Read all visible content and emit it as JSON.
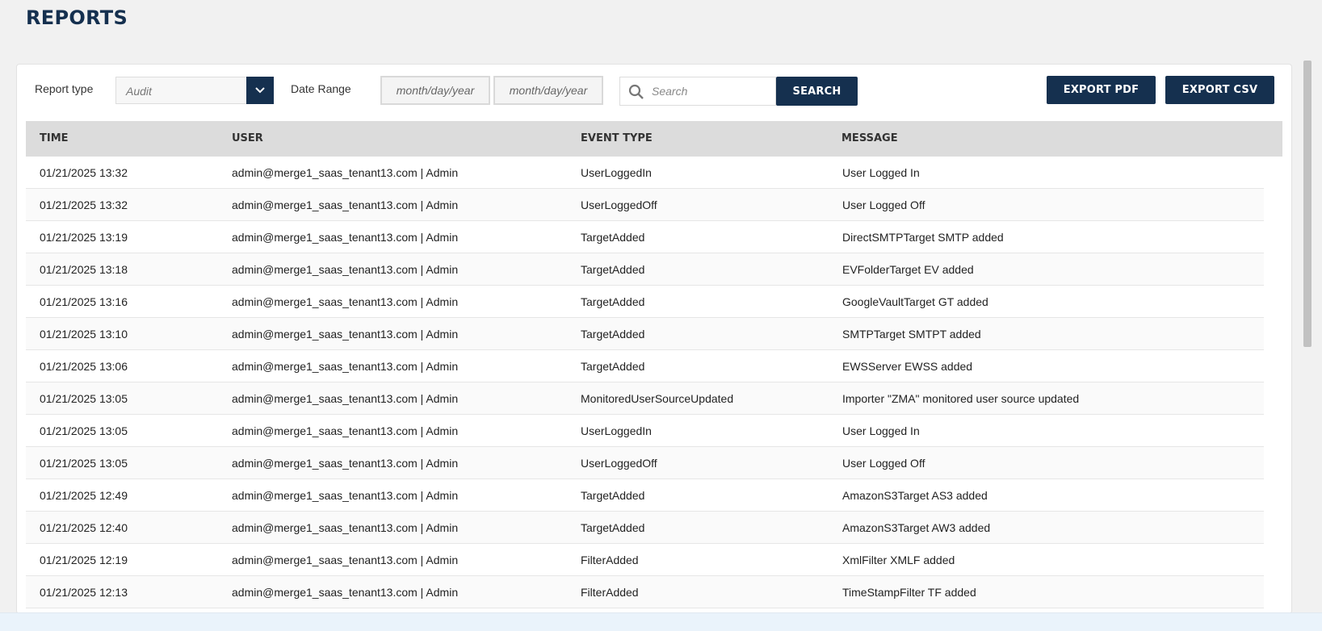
{
  "page": {
    "title": "REPORTS"
  },
  "toolbar": {
    "report_type_label": "Report type",
    "report_type_value": "Audit",
    "date_range_label": "Date Range",
    "date_from_placeholder": "month/day/year",
    "date_to_placeholder": "month/day/year",
    "search_placeholder": "Search",
    "search_button": "SEARCH",
    "export_pdf": "EXPORT PDF",
    "export_csv": "EXPORT CSV"
  },
  "table": {
    "headers": [
      "TIME",
      "USER",
      "EVENT TYPE",
      "MESSAGE"
    ],
    "rows": [
      [
        "01/21/2025 13:32",
        "admin@merge1_saas_tenant13.com | Admin",
        "UserLoggedIn",
        "User Logged In"
      ],
      [
        "01/21/2025 13:32",
        "admin@merge1_saas_tenant13.com | Admin",
        "UserLoggedOff",
        "User Logged Off"
      ],
      [
        "01/21/2025 13:19",
        "admin@merge1_saas_tenant13.com | Admin",
        "TargetAdded",
        "DirectSMTPTarget SMTP added"
      ],
      [
        "01/21/2025 13:18",
        "admin@merge1_saas_tenant13.com | Admin",
        "TargetAdded",
        "EVFolderTarget EV added"
      ],
      [
        "01/21/2025 13:16",
        "admin@merge1_saas_tenant13.com | Admin",
        "TargetAdded",
        "GoogleVaultTarget GT added"
      ],
      [
        "01/21/2025 13:10",
        "admin@merge1_saas_tenant13.com | Admin",
        "TargetAdded",
        "SMTPTarget SMTPT added"
      ],
      [
        "01/21/2025 13:06",
        "admin@merge1_saas_tenant13.com | Admin",
        "TargetAdded",
        "EWSServer EWSS added"
      ],
      [
        "01/21/2025 13:05",
        "admin@merge1_saas_tenant13.com | Admin",
        "MonitoredUserSourceUpdated",
        "Importer \"ZMA\" monitored user source updated"
      ],
      [
        "01/21/2025 13:05",
        "admin@merge1_saas_tenant13.com | Admin",
        "UserLoggedIn",
        "User Logged In"
      ],
      [
        "01/21/2025 13:05",
        "admin@merge1_saas_tenant13.com | Admin",
        "UserLoggedOff",
        "User Logged Off"
      ],
      [
        "01/21/2025 12:49",
        "admin@merge1_saas_tenant13.com | Admin",
        "TargetAdded",
        "AmazonS3Target AS3 added"
      ],
      [
        "01/21/2025 12:40",
        "admin@merge1_saas_tenant13.com | Admin",
        "TargetAdded",
        "AmazonS3Target AW3 added"
      ],
      [
        "01/21/2025 12:19",
        "admin@merge1_saas_tenant13.com | Admin",
        "FilterAdded",
        "XmlFilter XMLF added"
      ],
      [
        "01/21/2025 12:13",
        "admin@merge1_saas_tenant13.com | Admin",
        "FilterAdded",
        "TimeStampFilter TF added"
      ]
    ]
  },
  "colors": {
    "primary": "#15304f",
    "header_bg": "#dcdcdc"
  },
  "icons": {
    "select": "chevron-down-icon",
    "search": "search-icon"
  }
}
